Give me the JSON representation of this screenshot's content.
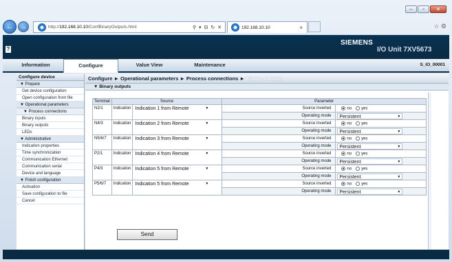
{
  "browser": {
    "url_prefix": "http://",
    "url_host": "192.168.10.10",
    "url_path": "/ConfBinaryOutputs.html",
    "url_controls": "⚲ ▾ ⊟ ↻ ✕",
    "tab_title": "192.168.10.10",
    "tab_close": "×",
    "toolbar_icons": "☆ ⚙"
  },
  "header": {
    "brand": "SIEMENS",
    "unit": "I/O  Unit 7XV5673",
    "help": "?"
  },
  "topnav": {
    "items": [
      "Information",
      "Configure",
      "Value View",
      "Maintenance"
    ],
    "active": 1,
    "device_id": "S_IO_00001"
  },
  "sidebar": {
    "title": "Configure device",
    "items": [
      {
        "type": "grp",
        "label": "▼ Prepare"
      },
      {
        "type": "lnk",
        "label": "Get device configuration"
      },
      {
        "type": "lnk",
        "label": "Open configuration from file"
      },
      {
        "type": "grp",
        "label": "▼ Operational parameters"
      },
      {
        "type": "sub",
        "label": "▼ Process connections"
      },
      {
        "type": "lnk",
        "label": "Binary inputs"
      },
      {
        "type": "lnk",
        "label": "Binary outputs"
      },
      {
        "type": "lnk",
        "label": "LEDs"
      },
      {
        "type": "grp",
        "label": "▼ Administrative"
      },
      {
        "type": "lnk",
        "label": "Indication properties"
      },
      {
        "type": "lnk",
        "label": "Time synchronization"
      },
      {
        "type": "lnk",
        "label": "Communication Ethernet"
      },
      {
        "type": "lnk",
        "label": "Communication serial"
      },
      {
        "type": "lnk",
        "label": "Device and language"
      },
      {
        "type": "grp",
        "label": "▼ Finish configuration"
      },
      {
        "type": "lnk",
        "label": "Activation"
      },
      {
        "type": "lnk",
        "label": "Save configuration to file"
      },
      {
        "type": "lnk",
        "label": "Cancel"
      }
    ]
  },
  "breadcrumb": {
    "parts": [
      "Configure",
      "Operational parameters",
      "Process connections"
    ],
    "sep": "►",
    "last": "Binary outputs"
  },
  "section": "▼ Binary outputs",
  "table": {
    "headers": {
      "terminal": "Terminal",
      "source": "Source",
      "parameter": "Parameter"
    },
    "rows": [
      {
        "terminal": "N2/1",
        "type": "Indication",
        "source": "Indication 1 from Remote"
      },
      {
        "terminal": "N4/3",
        "type": "Indication",
        "source": "Indication 2 from Remote"
      },
      {
        "terminal": "N5/6/7",
        "type": "Indication",
        "source": "Indication 3 from Remote"
      },
      {
        "terminal": "P2/1",
        "type": "Indication",
        "source": "Indication 4 from Remote"
      },
      {
        "terminal": "P4/3",
        "type": "Indication",
        "source": "Indication 5 from Remote"
      },
      {
        "terminal": "P5/6/7",
        "type": "Indication",
        "source": "Indication 5 from Remote"
      }
    ],
    "source_inverted_label": "Source inverted",
    "operating_mode_label": "Operating mode",
    "radio_no": "no",
    "radio_yes": "yes",
    "mode_value": "Persistent"
  },
  "send_label": "Send"
}
